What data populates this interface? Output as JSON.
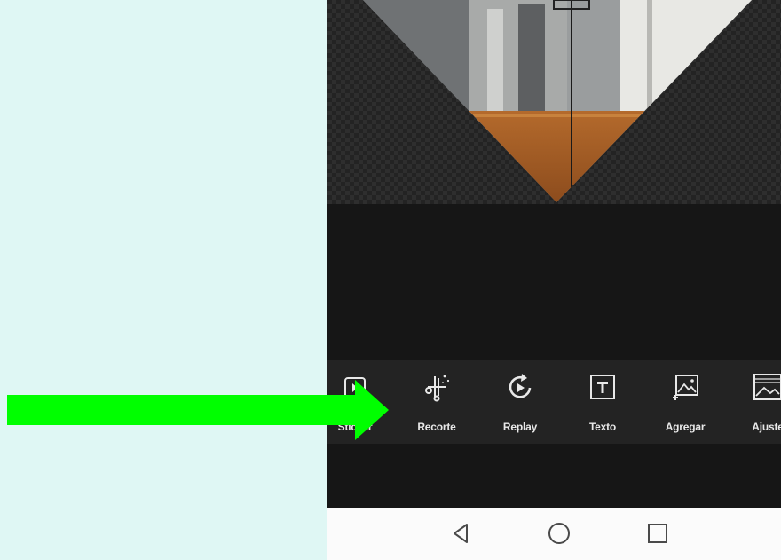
{
  "toolbar": {
    "items": [
      {
        "label": "Sticker",
        "icon": "sticker-icon"
      },
      {
        "label": "Recorte",
        "icon": "scissors-sparkle-icon"
      },
      {
        "label": "Replay",
        "icon": "replay-icon"
      },
      {
        "label": "Texto",
        "icon": "text-box-icon"
      },
      {
        "label": "Agregar",
        "icon": "add-image-icon"
      },
      {
        "label": "Ajuste",
        "icon": "adjust-image-icon"
      }
    ]
  },
  "navbar": {
    "back_icon": "triangle-back-icon",
    "home_icon": "circle-home-icon",
    "recents_icon": "square-recents-icon"
  },
  "annotation": {
    "arrow_color": "#00ff00",
    "arrow_icon": "right-arrow-icon"
  },
  "colors": {
    "page_background": "#dff7f4",
    "app_background": "#161616",
    "toolbar_background": "#232323",
    "navbar_background": "#fbfbfb"
  }
}
